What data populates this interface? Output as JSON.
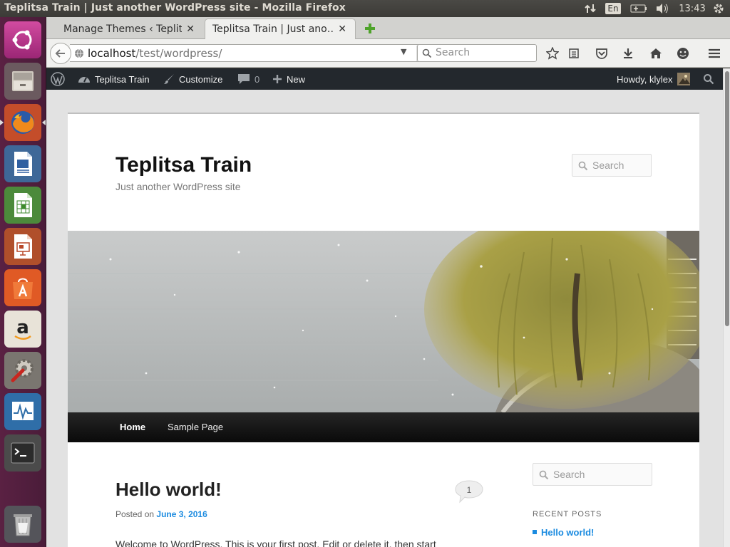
{
  "os_panel": {
    "window_title": "Teplitsa Train | Just another WordPress site - Mozilla Firefox",
    "keyboard_layout": "En",
    "clock": "13:43"
  },
  "launcher": {
    "items": [
      "ubuntu-dash",
      "files",
      "firefox",
      "libreoffice-writer",
      "libreoffice-calc",
      "libreoffice-impress",
      "ubuntu-software-center",
      "amazon",
      "system-settings",
      "system-monitor",
      "terminal",
      "trash"
    ]
  },
  "browser": {
    "tabs": [
      {
        "label": "Manage Themes ‹ Teplitsa Train",
        "display": "Manage Themes ‹ Teplit…",
        "active": false
      },
      {
        "label": "Teplitsa Train | Just another WordPress site",
        "display": "Teplitsa Train | Just ano…",
        "active": true
      }
    ],
    "url_host": "localhost",
    "url_path": "/test/wordpress/",
    "search_placeholder": "Search"
  },
  "admin_bar": {
    "site_name": "Teplitsa Train",
    "customize": "Customize",
    "comments_count": "0",
    "new_label": "New",
    "howdy": "Howdy, klylex"
  },
  "site": {
    "title": "Teplitsa Train",
    "description": "Just another WordPress site",
    "search_placeholder": "Search",
    "nav": [
      "Home",
      "Sample Page"
    ],
    "post": {
      "title": "Hello world!",
      "comment_count": "1",
      "posted_on_label": "Posted on",
      "date": "June 3, 2016",
      "excerpt": "Welcome to WordPress. This is your first post. Edit or delete it, then start"
    },
    "sidebar": {
      "search_placeholder": "Search",
      "recent_posts_heading": "RECENT POSTS",
      "recent_posts": [
        "Hello world!"
      ]
    }
  },
  "colors": {
    "launcher": "#5a2143",
    "admin_bar": "#23282d",
    "link": "#1b8be0",
    "nav_bar": "#111111"
  }
}
